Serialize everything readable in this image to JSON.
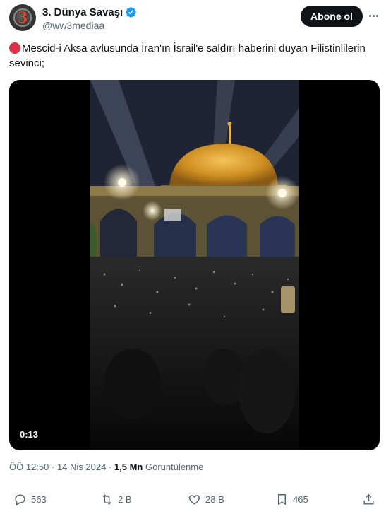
{
  "account": {
    "display_name": "3. Dünya Savaşı",
    "handle": "@ww3mediaa",
    "avatar_text": "3",
    "verified": true
  },
  "follow_label": "Abone ol",
  "tweet": {
    "emoji": "red-circle",
    "text": "Mescid-i Aksa avlusunda İran'ın İsrail'e saldırı haberini duyan Filistinlilerin sevinci;"
  },
  "media": {
    "type": "video",
    "duration": "0:13"
  },
  "meta": {
    "time": "ÖÖ 12:50",
    "separator": " · ",
    "date": "14 Nis 2024",
    "views_count": "1,5 Mn",
    "views_label": " Görüntülenme"
  },
  "actions": {
    "replies": "563",
    "reposts": "2 B",
    "likes": "28 B",
    "bookmarks": "465"
  },
  "colors": {
    "text": "#0f1419",
    "secondary": "#536471",
    "verified": "#1d9bf0",
    "red_circle": "#dd2e44",
    "follow_bg": "#0f1419"
  }
}
